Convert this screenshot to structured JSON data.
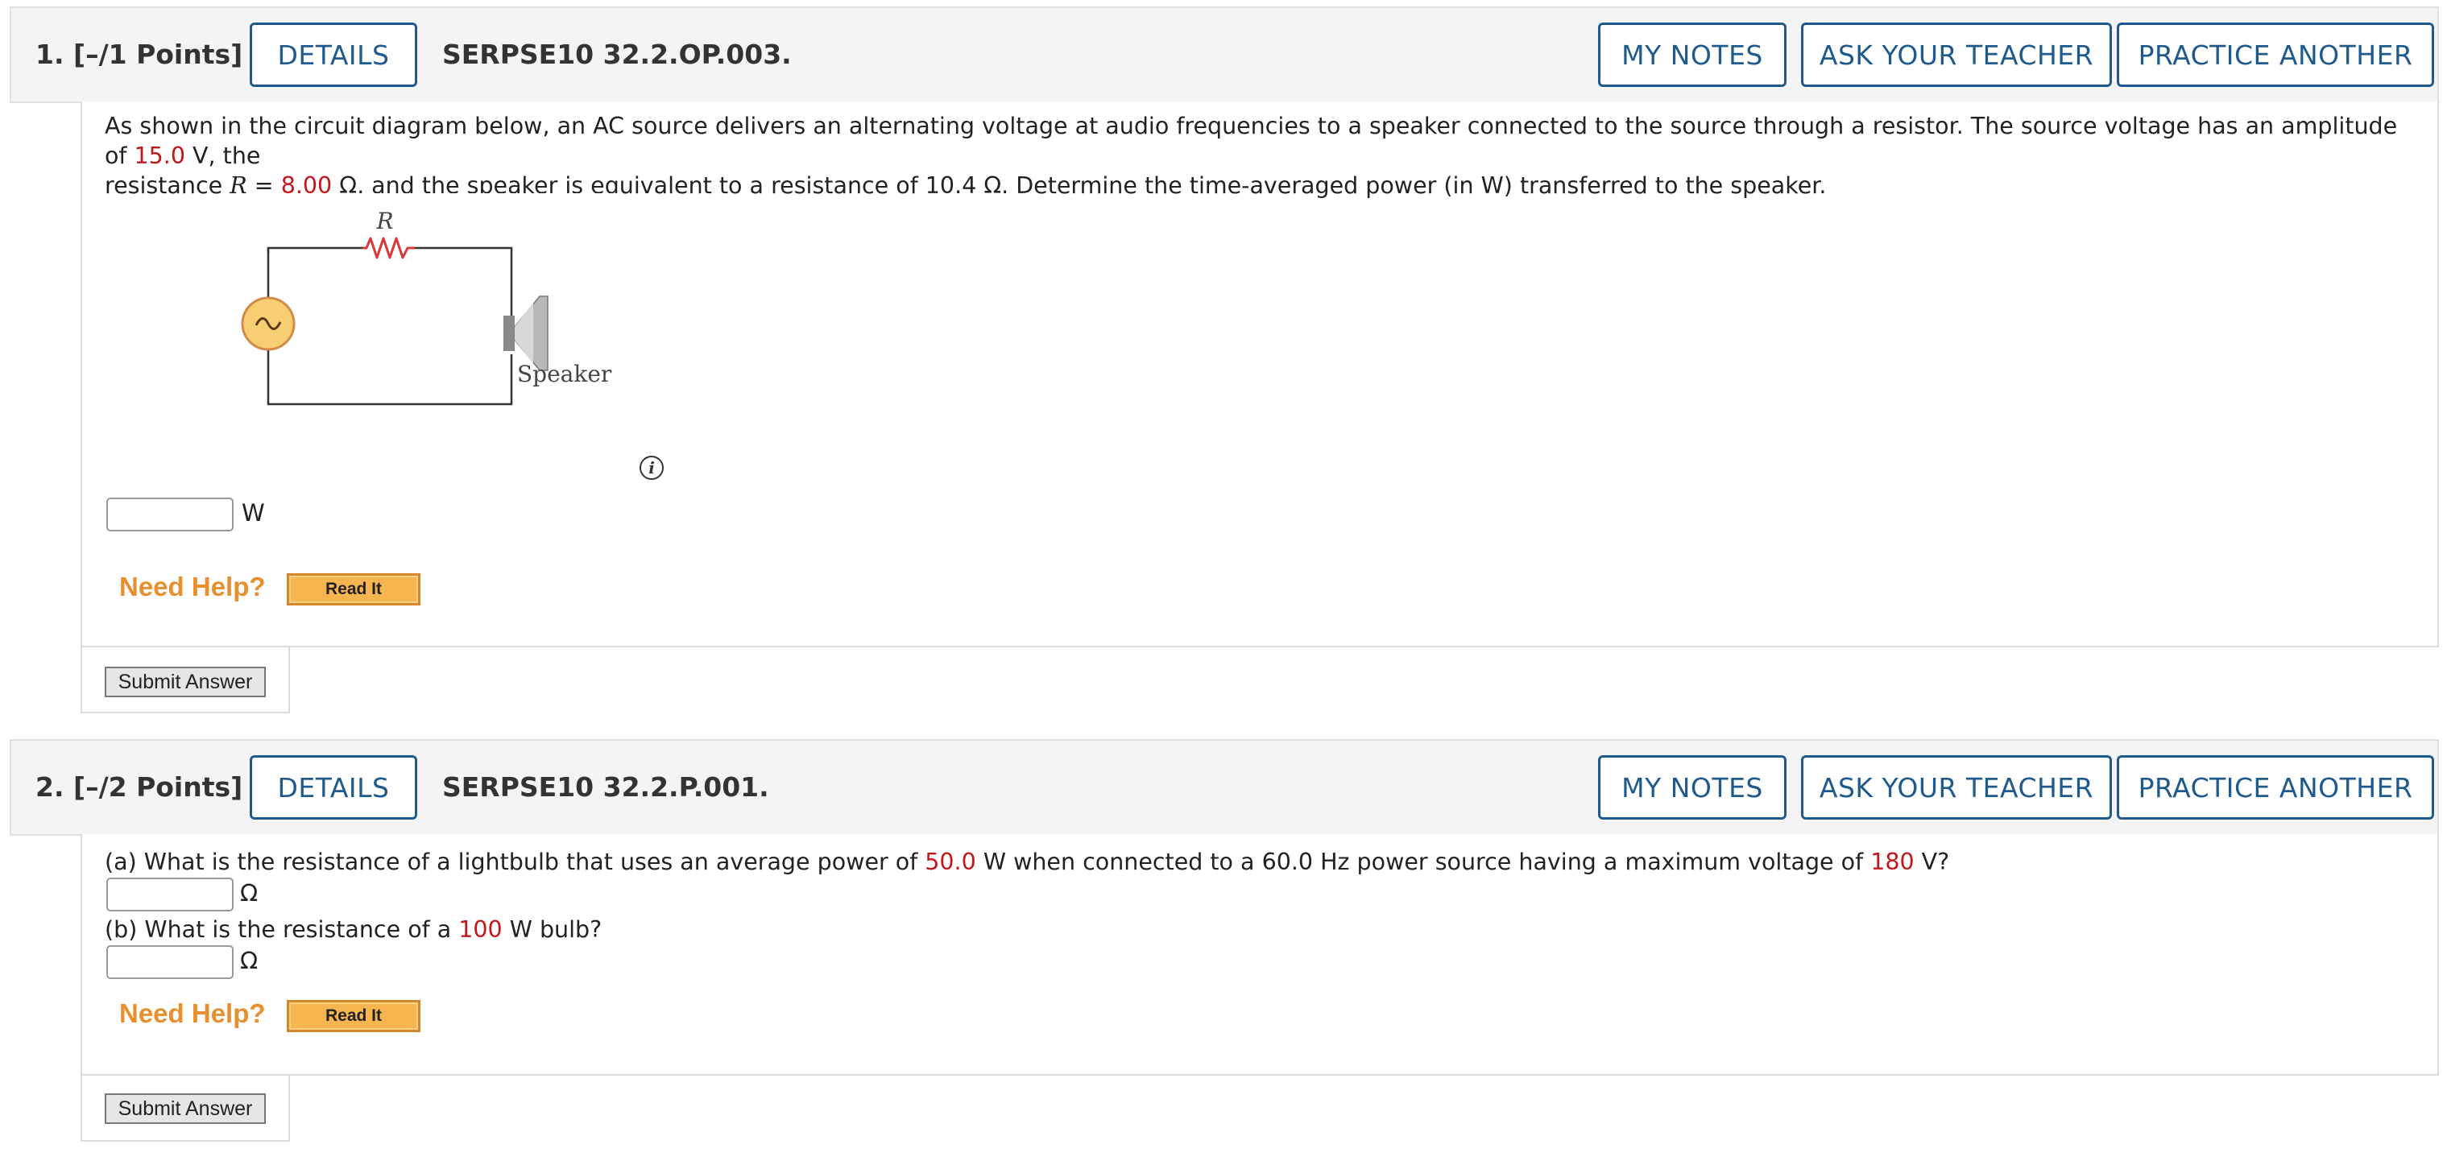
{
  "q1": {
    "number": "1.  [–/1 Points]",
    "details": "DETAILS",
    "code": "SERPSE10 32.2.OP.003.",
    "my_notes": "MY NOTES",
    "ask_teacher": "ASK YOUR TEACHER",
    "practice": "PRACTICE ANOTHER",
    "text_a": "As shown in the circuit diagram below, an AC source delivers an alternating voltage at audio frequencies to a speaker connected to the source through a resistor. The source voltage has an amplitude of ",
    "amp": "15.0",
    "text_b": " V, the",
    "text_c": "resistance ",
    "R": "R",
    "text_d": " = ",
    "res": "8.00",
    "text_e": " Ω, and the speaker is equivalent to a resistance of 10.4 Ω. Determine the time-averaged power (in W) transferred to the speaker.",
    "diagram_R": "R",
    "diagram_speaker": "Speaker",
    "unit": "W",
    "need_help": "Need Help?",
    "read_it": "Read It",
    "submit": "Submit Answer",
    "answer_value": ""
  },
  "q2": {
    "number": "2.  [–/2 Points]",
    "details": "DETAILS",
    "code": "SERPSE10 32.2.P.001.",
    "my_notes": "MY NOTES",
    "ask_teacher": "ASK YOUR TEACHER",
    "practice": "PRACTICE ANOTHER",
    "a_text1": "(a) What is the resistance of a lightbulb that uses an average power of ",
    "a_power": "50.0",
    "a_text2": " W when connected to a 60.0 Hz power source having a maximum voltage of ",
    "a_volt": "180",
    "a_text3": " V?",
    "a_unit": "Ω",
    "b_text1": "(b) What is the resistance of a ",
    "b_power": "100",
    "b_text2": " W bulb?",
    "b_unit": "Ω",
    "need_help": "Need Help?",
    "read_it": "Read It",
    "submit": "Submit Answer",
    "answer_a_value": "",
    "answer_b_value": ""
  },
  "colors": {
    "accent_blue": "#1f5a8e",
    "value_red": "#c4171c",
    "help_orange": "#e8902f"
  }
}
